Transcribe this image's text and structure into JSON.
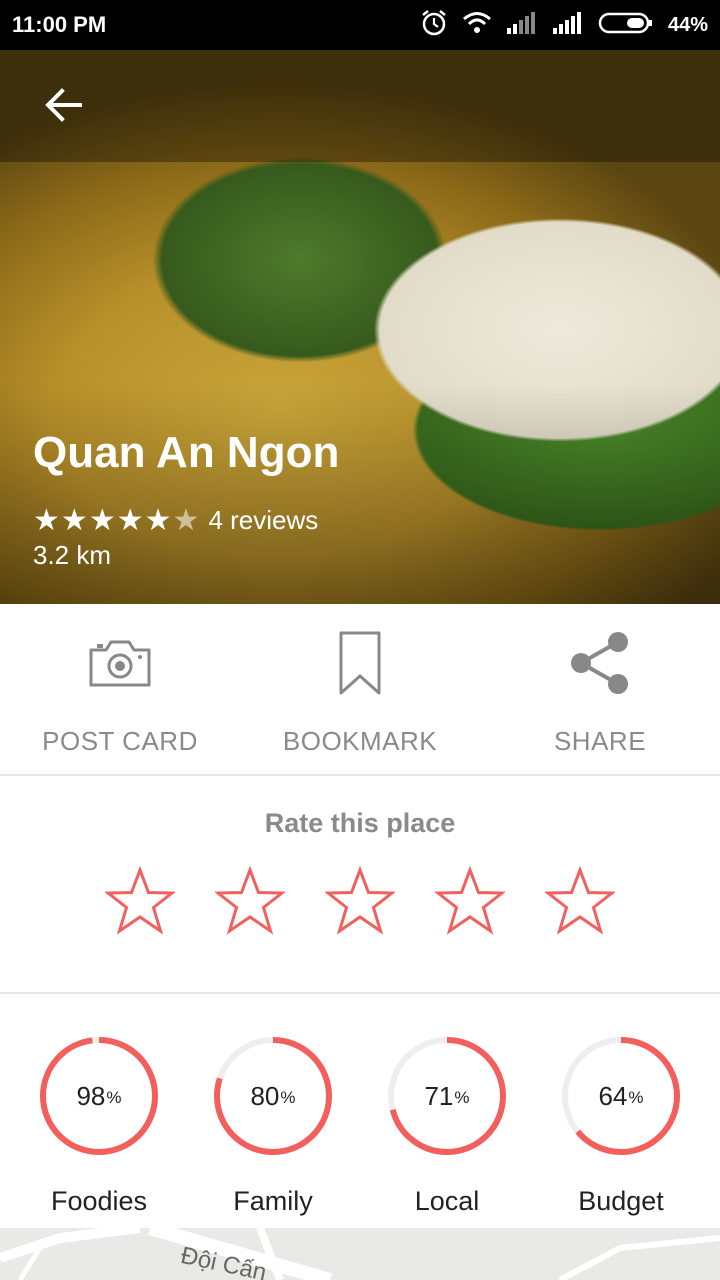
{
  "status_bar": {
    "time": "11:00 PM",
    "battery_percent": "44%",
    "icons": [
      "alarm-icon",
      "wifi-icon",
      "signal-icon",
      "signal-icon",
      "battery-icon"
    ]
  },
  "hero": {
    "title": "Quan An Ngon",
    "rating": 5,
    "rating_max": 6,
    "reviews": "4 reviews",
    "distance": "3.2 km"
  },
  "actions": [
    {
      "label": "POST CARD",
      "icon": "camera-icon"
    },
    {
      "label": "BOOKMARK",
      "icon": "bookmark-icon"
    },
    {
      "label": "SHARE",
      "icon": "share-icon"
    }
  ],
  "rate": {
    "title": "Rate this place",
    "star_count": 5
  },
  "stats": [
    {
      "value": "98",
      "unit": "%",
      "label": "Foodies",
      "fraction": 0.98
    },
    {
      "value": "80",
      "unit": "%",
      "label": "Family",
      "fraction": 0.8
    },
    {
      "value": "71",
      "unit": "%",
      "label": "Local",
      "fraction": 0.71
    },
    {
      "value": "64",
      "unit": "%",
      "label": "Budget",
      "fraction": 0.64
    }
  ],
  "map": {
    "street_label": "Đội Cấn"
  },
  "colors": {
    "accent": "#f25f5c",
    "ring_track": "#eeeeee",
    "muted_text": "#8a8a8a"
  }
}
